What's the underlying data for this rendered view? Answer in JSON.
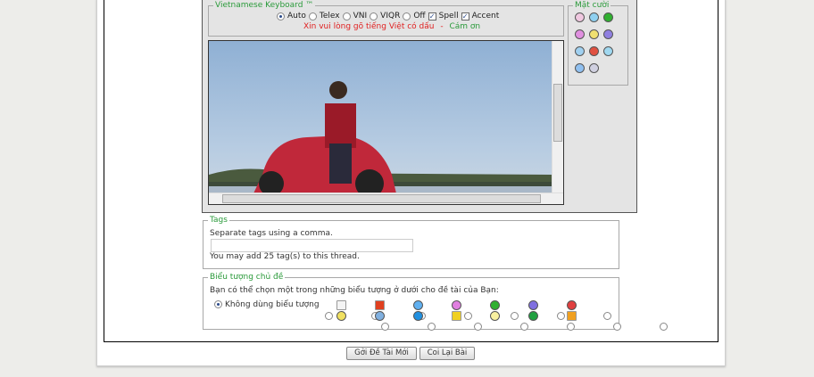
{
  "keyboard": {
    "legend": "Vietnamese Keyboard ™",
    "modes": [
      "Auto",
      "Telex",
      "VNI",
      "VIQR",
      "Off"
    ],
    "selected": "Auto",
    "spell_label": "Spell",
    "spell_checked": true,
    "accent_label": "Accent",
    "accent_checked": true,
    "message_red": "Xin vui lòng gõ tiếng Việt có dấu",
    "separator": "-",
    "message_green": "Cám ơn",
    "red": "#e02020",
    "green": "#2a9a3a"
  },
  "smilies": {
    "legend": "Mặt cười",
    "icons": [
      "wink-smiley-icon",
      "smile-smiley-icon",
      "grin-smiley-icon",
      "tongue-smiley-icon",
      "happy-smiley-icon",
      "purple-smiley-icon",
      "confused-smiley-icon",
      "mad-smiley-icon",
      "rolleyes-smiley-icon",
      "cool-smiley-icon",
      "eek-smiley-icon"
    ],
    "colors": [
      "#f0c8e0",
      "#8fd0f0",
      "#30b030",
      "#e090e0",
      "#f0e070",
      "#9080e0",
      "#a0d0f0",
      "#e05040",
      "#a0d8f0",
      "#90c0f0",
      "#d0d0e0"
    ]
  },
  "tags": {
    "legend": "Tags",
    "hint": "Separate tags using a comma.",
    "value": "",
    "note": "You may add 25 tag(s) to this thread."
  },
  "icons": {
    "legend": "Biểu tượng chủ đề",
    "prompt": "Bạn có thể chọn một trong những biểu tượng ở dưới cho đề tài của Bạn:",
    "none_label": "Không dùng biểu tượng",
    "none_selected": true,
    "items": [
      "post-icon",
      "thumbs-down-icon",
      "wink-icon",
      "tongue-icon",
      "grin-icon",
      "purple-smile-icon",
      "mad-icon",
      "smile-icon",
      "cool-icon",
      "question-icon",
      "warning-icon",
      "lightbulb-icon",
      "arrow-icon",
      "thumbs-up-icon"
    ],
    "colors": [
      "#f4f4f4",
      "#e04020",
      "#60b0f0",
      "#e080e0",
      "#30b030",
      "#8070e0",
      "#e04040",
      "#f0e060",
      "#80b0e0",
      "#2090e0",
      "#f0d020",
      "#f8f0a0",
      "#20a040",
      "#f0a020"
    ]
  },
  "buttons": {
    "submit": "Gởi Đề Tài Mới",
    "preview": "Coi Lại Bài"
  }
}
